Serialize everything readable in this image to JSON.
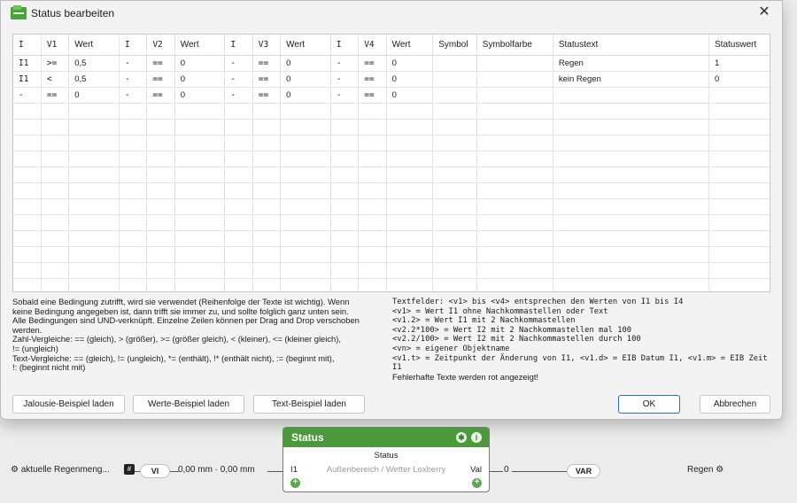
{
  "dialog": {
    "title": "Status bearbeiten",
    "close_glyph": "✕"
  },
  "table": {
    "headers": [
      "I",
      "V1",
      "Wert",
      "I",
      "V2",
      "Wert",
      "I",
      "V3",
      "Wert",
      "I",
      "V4",
      "Wert",
      "Symbol",
      "Symbolfarbe",
      "Statustext",
      "Statuswert"
    ],
    "rows": [
      [
        "I1",
        ">=",
        "0,5",
        "-",
        "==",
        "0",
        "-",
        "==",
        "0",
        "-",
        "==",
        "0",
        "",
        "",
        "Regen",
        "1"
      ],
      [
        "I1",
        "<",
        "0,5",
        "-",
        "==",
        "0",
        "-",
        "==",
        "0",
        "-",
        "==",
        "0",
        "",
        "",
        "kein Regen",
        "0"
      ],
      [
        "-",
        "==",
        "0",
        "-",
        "==",
        "0",
        "-",
        "==",
        "0",
        "-",
        "==",
        "0",
        "",
        "",
        "",
        ""
      ]
    ]
  },
  "help_left": [
    "Sobald eine Bedingung zutrifft, wird sie verwendet (Reihenfolge der Texte ist wichtig). Wenn",
    "keine Bedingung angegeben ist, dann trifft sie immer zu, und sollte folglich ganz unten sein.",
    "Alle Bedingungen sind UND-verknüpft. Einzelne Zeilen können per Drag and Drop verschoben",
    "werden.",
    "Zahl-Vergleiche: == (gleich), > (größer), >= (größer gleich), < (kleiner), <= (kleiner gleich),",
    "!= (ungleich)",
    "Text-Vergleiche: == (gleich), != (ungleich), *= (enthält), !* (enthält nicht), := (beginnt mit),",
    "!: (beginnt nicht mit)"
  ],
  "help_right": [
    "Textfelder: <v1> bis <v4> entsprechen den Werten von I1 bis I4",
    "<v1> = Wert I1 ohne Nachkommastellen oder Text",
    "<v1.2> = Wert I1 mit 2 Nachkommastellen",
    "<v2.2*100> = Wert I2 mit 2 Nachkommastellen mal 100",
    "<v2.2/100> = Wert I2 mit 2 Nachkommastellen durch 100",
    "<vn> = eigener Objektname",
    "<v1.t> = Zeitpunkt der Änderung von I1, <v1.d> = EIB Datum I1, <v1.m> = EIB Zeit I1",
    "Fehlerhafte Texte werden rot angezeigt!"
  ],
  "buttons": {
    "jalousie": "Jalousie-Beispiel laden",
    "werte": "Werte-Beispiel laden",
    "text": "Text-Beispiel laden",
    "ok": "OK",
    "cancel": "Abbrechen"
  },
  "canvas": {
    "block_title": "Status",
    "block_subtitle": "Status",
    "block_description": "Außenbereich / Wetter Loxberry",
    "input_port": "I1",
    "output_port": "Val",
    "input_source": "aktuelle Regenmeng...",
    "input_pill": "VI",
    "input_value": "0,00 mm · 0,00 mm",
    "output_value": "0",
    "output_pill": "VAR",
    "output_target": "Regen"
  },
  "colors": {
    "block_header": "#4a9a3c",
    "ok_border": "#2a73c7"
  }
}
